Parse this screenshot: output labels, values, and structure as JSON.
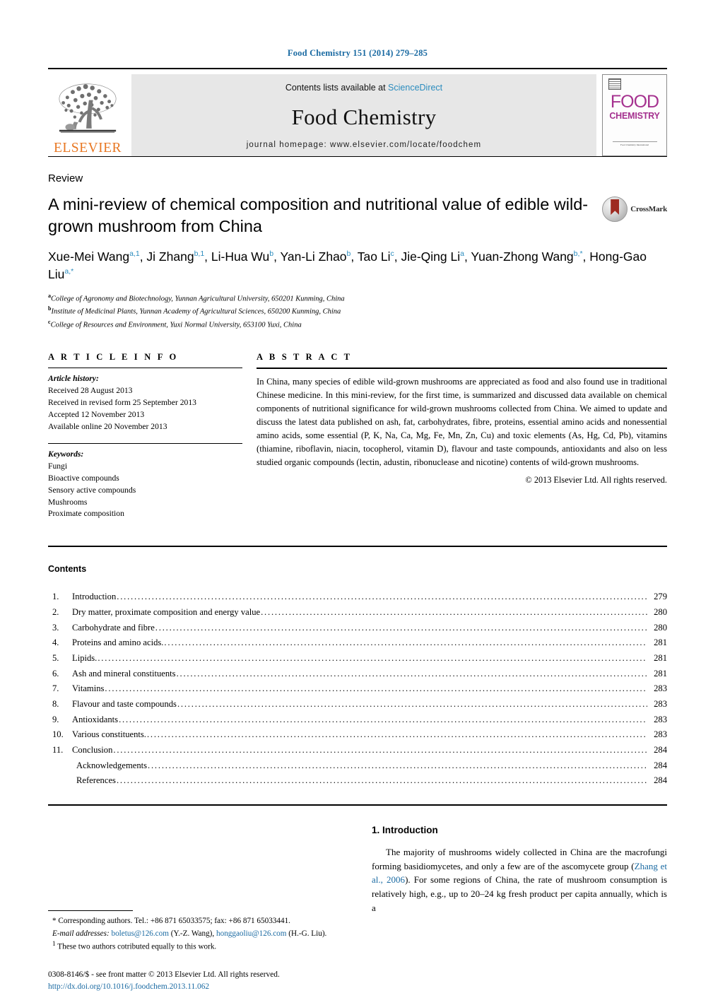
{
  "running_head": "Food Chemistry 151 (2014) 279–285",
  "masthead": {
    "contents_prefix": "Contents lists available at ",
    "sciencedirect": "ScienceDirect",
    "journal_title": "Food Chemistry",
    "homepage": "journal homepage: www.elsevier.com/locate/foodchem",
    "publisher": "ELSEVIER",
    "cover_food": "FOOD",
    "cover_chemistry": "CHEMISTRY",
    "cover_footer": "Food Chemistry International",
    "accent_link_color": "#2b8cbe",
    "elsevier_orange": "#E87722",
    "journal_magenta": "#A5318F"
  },
  "article": {
    "doctype": "Review",
    "title": "A mini-review of chemical composition and nutritional value of edible wild-grown mushroom from China",
    "crossmark_label": "CrossMark",
    "authors_html": "Xue-Mei Wang<sup>a,1</sup>, Ji Zhang<sup>b,1</sup>, Li-Hua Wu<sup>b</sup>, Yan-Li Zhao<sup>b</sup>, Tao Li<sup>c</sup>, Jie-Qing Li<sup>a</sup>, Yuan-Zhong Wang<sup>b,</sup><sup>*</sup>, Hong-Gao Liu<sup>a,</sup><sup>*</sup>",
    "affiliations": [
      {
        "mark": "a",
        "text": "College of Agronomy and Biotechnology, Yunnan Agricultural University, 650201 Kunming, China"
      },
      {
        "mark": "b",
        "text": "Institute of Medicinal Plants, Yunnan Academy of Agricultural Sciences, 650200 Kunming, China"
      },
      {
        "mark": "c",
        "text": "College of Resources and Environment, Yuxi Normal University, 653100 Yuxi, China"
      }
    ]
  },
  "article_info": {
    "heading": "A R T I C L E    I N F O",
    "history_label": "Article history:",
    "history": [
      "Received 28 August 2013",
      "Received in revised form 25 September 2013",
      "Accepted 12 November 2013",
      "Available online 20 November 2013"
    ],
    "keywords_label": "Keywords:",
    "keywords": [
      "Fungi",
      "Bioactive compounds",
      "Sensory active compounds",
      "Mushrooms",
      "Proximate composition"
    ]
  },
  "abstract": {
    "heading": "A B S T R A C T",
    "text": "In China, many species of edible wild-grown mushrooms are appreciated as food and also found use in traditional Chinese medicine. In this mini-review, for the first time, is summarized and discussed data available on chemical components of nutritional significance for wild-grown mushrooms collected from China. We aimed to update and discuss the latest data published on ash, fat, carbohydrates, fibre, proteins, essential amino acids and nonessential amino acids, some essential (P, K, Na, Ca, Mg, Fe, Mn, Zn, Cu) and toxic elements (As, Hg, Cd, Pb), vitamins (thiamine, riboflavin, niacin, tocopherol, vitamin D), flavour and taste compounds, antioxidants and also on less studied organic compounds (lectin, adustin, ribonuclease and nicotine) contents of wild-grown mushrooms.",
    "copyright": "© 2013 Elsevier Ltd. All rights reserved."
  },
  "contents": {
    "heading": "Contents",
    "entries": [
      {
        "num": "1.",
        "label": "Introduction",
        "page": "279",
        "sub": false
      },
      {
        "num": "2.",
        "label": "Dry matter, proximate composition and energy value",
        "page": "280",
        "sub": false
      },
      {
        "num": "3.",
        "label": "Carbohydrate and fibre",
        "page": "280",
        "sub": false
      },
      {
        "num": "4.",
        "label": "Proteins and amino acids.",
        "page": "281",
        "sub": false
      },
      {
        "num": "5.",
        "label": "Lipids.",
        "page": "281",
        "sub": false
      },
      {
        "num": "6.",
        "label": "Ash and mineral constituents",
        "page": "281",
        "sub": false
      },
      {
        "num": "7.",
        "label": "Vitamins",
        "page": "283",
        "sub": false
      },
      {
        "num": "8.",
        "label": "Flavour and taste compounds",
        "page": "283",
        "sub": false
      },
      {
        "num": "9.",
        "label": "Antioxidants",
        "page": "283",
        "sub": false
      },
      {
        "num": "10.",
        "label": "Various constituents.",
        "page": "283",
        "sub": false
      },
      {
        "num": "11.",
        "label": "Conclusion",
        "page": "284",
        "sub": false
      },
      {
        "num": "",
        "label": "Acknowledgements",
        "page": "284",
        "sub": true
      },
      {
        "num": "",
        "label": "References",
        "page": "284",
        "sub": true
      }
    ]
  },
  "footnotes": {
    "corresponding": "Corresponding authors. Tel.: +86 871 65033575; fax: +86 871 65033441.",
    "email_label": "E-mail addresses:",
    "email1": "boletus@126.com",
    "email1_owner": "(Y.-Z. Wang),",
    "email2": "honggaoliu@126.com",
    "email2_owner": "(H.-G. Liu).",
    "equal_contribution": "These two authors cotributed equally to this work.",
    "marker_star": "*",
    "marker_one": "1"
  },
  "issn_block": {
    "line1": "0308-8146/$ - see front matter © 2013 Elsevier Ltd. All rights reserved.",
    "doi": "http://dx.doi.org/10.1016/j.foodchem.2013.11.062"
  },
  "introduction": {
    "heading": "1. Introduction",
    "paragraph_pre": "The majority of mushrooms widely collected in China are the macrofungi forming basidiomycetes, and only a few are of the ascomycete group (",
    "citation": "Zhang et al., 2006",
    "paragraph_post": "). For some regions of China, the rate of mushroom consumption is relatively high, e.g., up to 20–24 kg fresh product per capita annually, which is a"
  }
}
